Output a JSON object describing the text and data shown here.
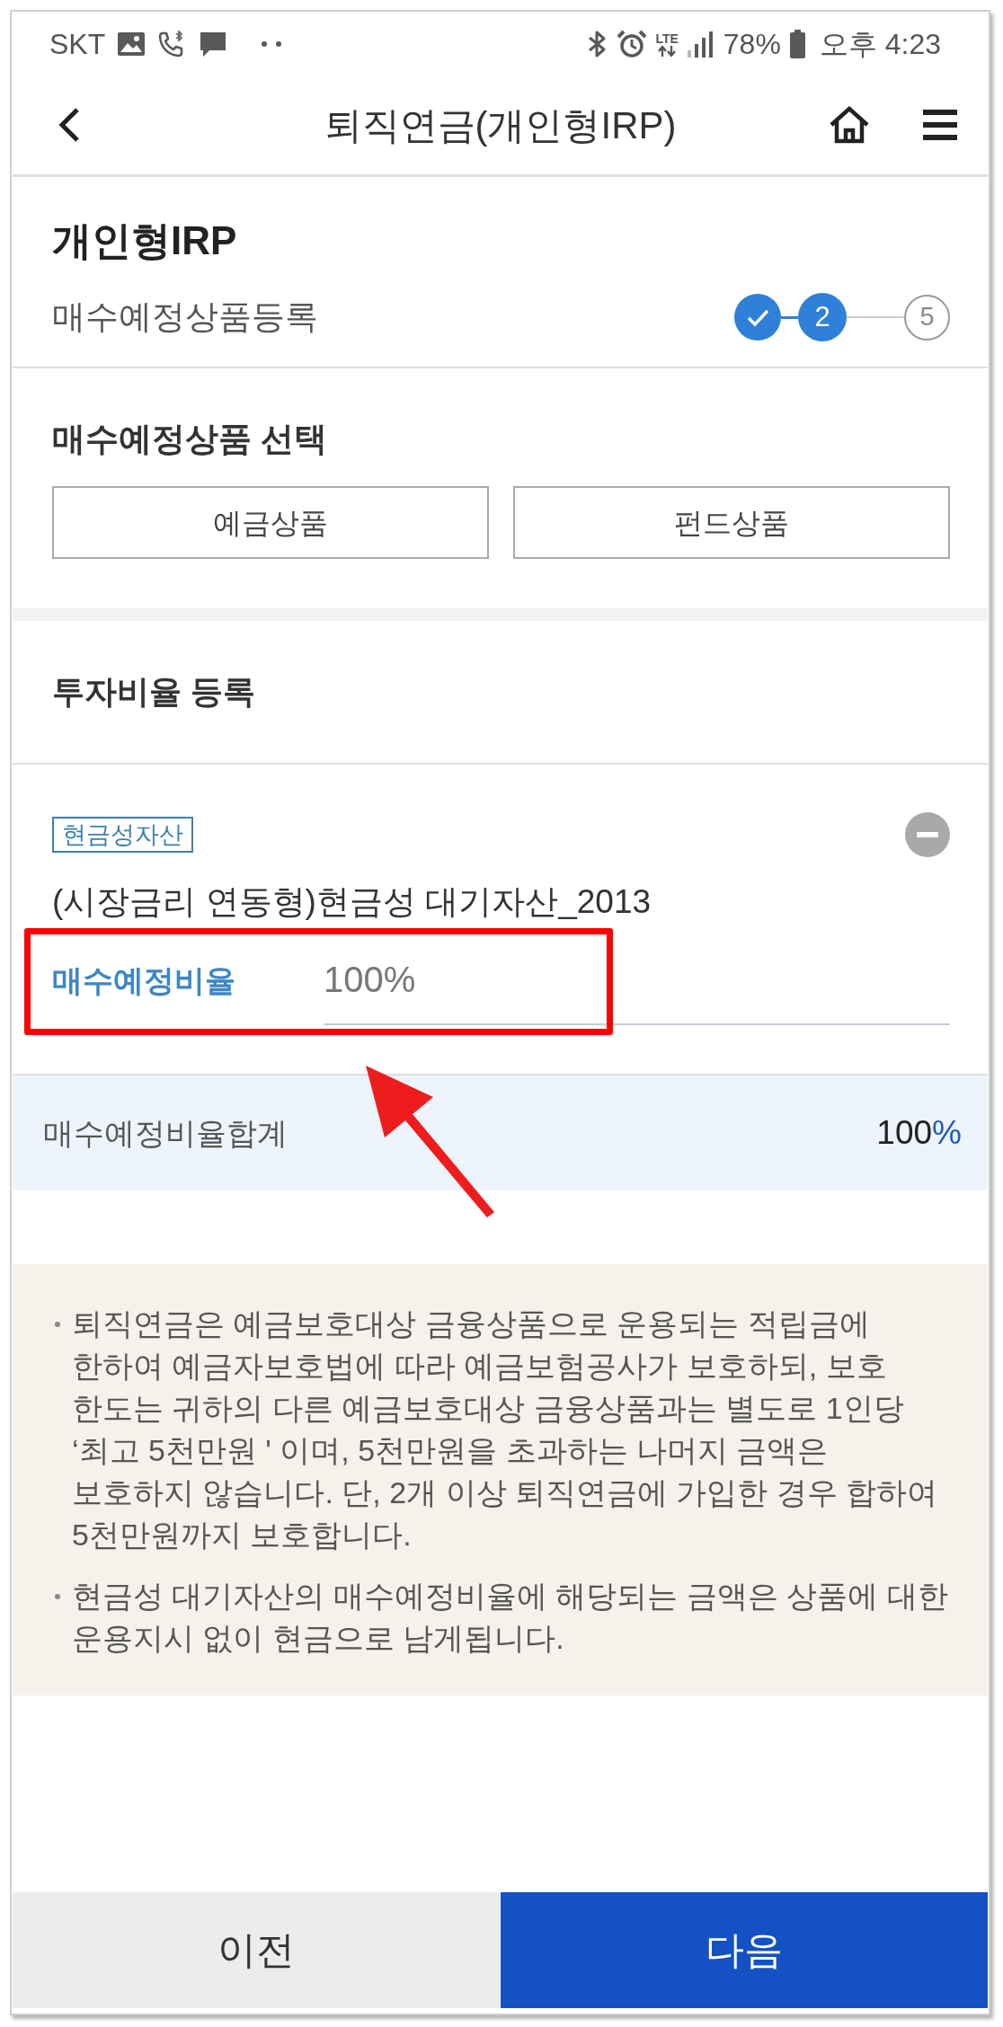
{
  "status_bar": {
    "carrier": "SKT",
    "network": "LTE",
    "battery": "78%",
    "time": "오후 4:23"
  },
  "header": {
    "title": "퇴직연금(개인형IRP)"
  },
  "product_header": {
    "title": "개인형IRP",
    "subtitle": "매수예정상품등록",
    "steps": [
      {
        "done": true,
        "selected": false
      },
      {
        "label": "2",
        "done": false,
        "selected": true
      },
      {
        "label": "5",
        "done": false,
        "selected": false
      }
    ]
  },
  "product_select": {
    "heading": "매수예정상품 선택",
    "buttons": [
      "예금상품",
      "펀드상품"
    ]
  },
  "ratio_section": {
    "heading": "투자비율 등록",
    "items": [
      {
        "tag": "현금성자산",
        "name": "(시장금리 연동형)현금성 대기자산_2013",
        "ratio_label": "매수예정비율",
        "ratio_value": "100%"
      }
    ],
    "total": {
      "label": "매수예정비율합계",
      "value": "100",
      "unit": "%"
    }
  },
  "notices": [
    "퇴직연금은 예금보호대상 금융상품으로 운용되는 적립금에 한하여 예금자보호법에 따라 예금보험공사가 보호하되, 보호 한도는 귀하의 다른 예금보호대상 금융상품과는 별도로 1인당 ‘최고 5천만원 ' 이며, 5천만원을 초과하는 나머지 금액은 보호하지 않습니다. 단, 2개 이상 퇴직연금에 가입한 경우 합하여 5천만원까지 보호합니다.",
    "현금성 대기자산의 매수예정비율에 해당되는 금액은 상품에 대한 운용지시 없이 현금으로 남게됩니다."
  ],
  "footer": {
    "buttons": [
      {
        "label": "이전",
        "kind": "secondary"
      },
      {
        "label": "다음",
        "kind": "primary"
      }
    ]
  }
}
